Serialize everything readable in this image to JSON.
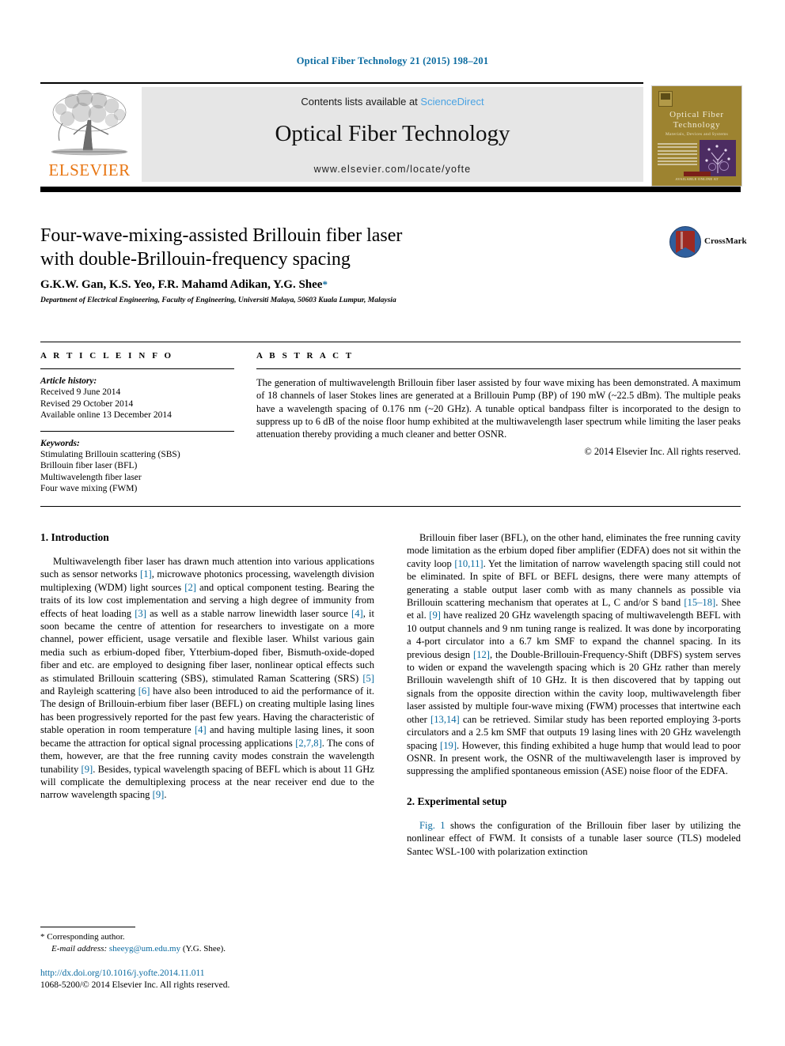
{
  "journal_ref": "Optical Fiber Technology 21 (2015) 198–201",
  "masthead": {
    "contents_prefix": "Contents lists available at ",
    "sciencedirect": "ScienceDirect",
    "journal_title": "Optical Fiber Technology",
    "url": "www.elsevier.com/locate/yofte",
    "publisher_wordmark": "ELSEVIER",
    "cover": {
      "title_line1": "Optical  Fiber",
      "title_line2": "Technology",
      "subtitle": "Materials, Devices and Systems",
      "footer": "AVAILABLE ONLINE AT",
      "badge_label": "SCIENCEDIRECT"
    }
  },
  "article": {
    "title_line1": "Four-wave-mixing-assisted Brillouin fiber laser",
    "title_line2": "with double-Brillouin-frequency spacing",
    "authors": "G.K.W. Gan, K.S. Yeo, F.R. Mahamd Adikan, Y.G. Shee",
    "corresponding_star": "*",
    "affiliation": "Department of Electrical Engineering, Faculty of Engineering, Universiti Malaya, 50603 Kuala Lumpur, Malaysia",
    "crossmark_label": "CrossMark"
  },
  "article_info": {
    "heading": "A R T I C L E   I N F O",
    "history_label": "Article history:",
    "history": [
      "Received 9 June 2014",
      "Revised 29 October 2014",
      "Available online 13 December 2014"
    ],
    "keywords_label": "Keywords:",
    "keywords": [
      "Stimulating Brillouin scattering (SBS)",
      "Brillouin fiber laser (BFL)",
      "Multiwavelength fiber laser",
      "Four wave mixing (FWM)"
    ]
  },
  "abstract": {
    "heading": "A B S T R A C T",
    "text": "The generation of multiwavelength Brillouin fiber laser assisted by four wave mixing has been demonstrated. A maximum of 18 channels of laser Stokes lines are generated at a Brillouin Pump (BP) of 190 mW (~22.5 dBm). The multiple peaks have a wavelength spacing of 0.176 nm (~20 GHz). A tunable optical bandpass filter is incorporated to the design to suppress up to 6 dB of the noise floor hump exhibited at the multiwavelength laser spectrum while limiting the laser peaks attenuation thereby providing a much cleaner and better OSNR.",
    "copyright": "© 2014 Elsevier Inc. All rights reserved."
  },
  "sections": {
    "intro_heading": "1. Introduction",
    "experimental_heading": "2. Experimental setup"
  },
  "body": {
    "left_para": "Multiwavelength fiber laser has drawn much attention into various applications such as sensor networks [1], microwave photonics processing, wavelength division multiplexing (WDM) light sources [2] and optical component testing. Bearing the traits of its low cost implementation and serving a high degree of immunity from effects of heat loading [3] as well as a stable narrow linewidth laser source [4], it soon became the centre of attention for researchers to investigate on a more channel, power efficient, usage versatile and flexible laser. Whilst various gain media such as erbium-doped fiber, Ytterbium-doped fiber, Bismuth-oxide-doped fiber and etc. are employed to designing fiber laser, nonlinear optical effects such as stimulated Brillouin scattering (SBS), stimulated Raman Scattering (SRS) [5] and Rayleigh scattering [6] have also been introduced to aid the performance of it. The design of Brillouin-erbium fiber laser (BEFL) on creating multiple lasing lines has been progressively reported for the past few years. Having the characteristic of stable operation in room temperature [4] and having multiple lasing lines, it soon became the attraction for optical signal processing applications [2,7,8]. The cons of them, however, are that the free running cavity modes constrain the wavelength tunability [9]. Besides, typical wavelength spacing of BEFL which is about 11 GHz will complicate the demultiplexing process at the near receiver end due to the narrow wavelength spacing [9].",
    "right_para": "Brillouin fiber laser (BFL), on the other hand, eliminates the free running cavity mode limitation as the erbium doped fiber amplifier (EDFA) does not sit within the cavity loop [10,11]. Yet the limitation of narrow wavelength spacing still could not be eliminated. In spite of BFL or BEFL designs, there were many attempts of generating a stable output laser comb with as many channels as possible via Brillouin scattering mechanism that operates at L, C and/or S band [15–18]. Shee et al. [9] have realized 20 GHz wavelength spacing of multiwavelength BEFL with 10 output channels and 9 nm tuning range is realized. It was done by incorporating a 4-port circulator into a 6.7 km SMF to expand the channel spacing. In its previous design [12], the Double-Brillouin-Frequency-Shift (DBFS) system serves to widen or expand the wavelength spacing which is 20 GHz rather than merely Brillouin wavelength shift of 10 GHz. It is then discovered that by tapping out signals from the opposite direction within the cavity loop, multiwavelength fiber laser assisted by multiple four-wave mixing (FWM) processes that intertwine each other [13,14] can be retrieved. Similar study has been reported employing 3-ports circulators and a 2.5 km SMF that outputs 19 lasing lines with 20 GHz wavelength spacing [19]. However, this finding exhibited a huge hump that would lead to poor OSNR. In present work, the OSNR of the multiwavelength laser is improved by suppressing the amplified spontaneous emission (ASE) noise floor of the EDFA.",
    "experimental_para": "Fig. 1 shows the configuration of the Brillouin fiber laser by utilizing the nonlinear effect of FWM. It consists of a tunable laser source (TLS) modeled Santec WSL-100 with polarization extinction"
  },
  "footer": {
    "corresponding_mark": "*",
    "corresponding_label": "Corresponding author.",
    "email_label": "E-mail address:",
    "email": "sheeyg@um.edu.my",
    "email_owner": "(Y.G. Shee).",
    "doi": "http://dx.doi.org/10.1016/j.yofte.2014.11.011",
    "issn_line": "1068-5200/© 2014 Elsevier Inc. All rights reserved."
  },
  "colors": {
    "link": "#0b6ba0",
    "sciencedirect": "#4ba3e3",
    "elsevier_orange": "#e87511",
    "cover_bg": "#9d8330"
  }
}
